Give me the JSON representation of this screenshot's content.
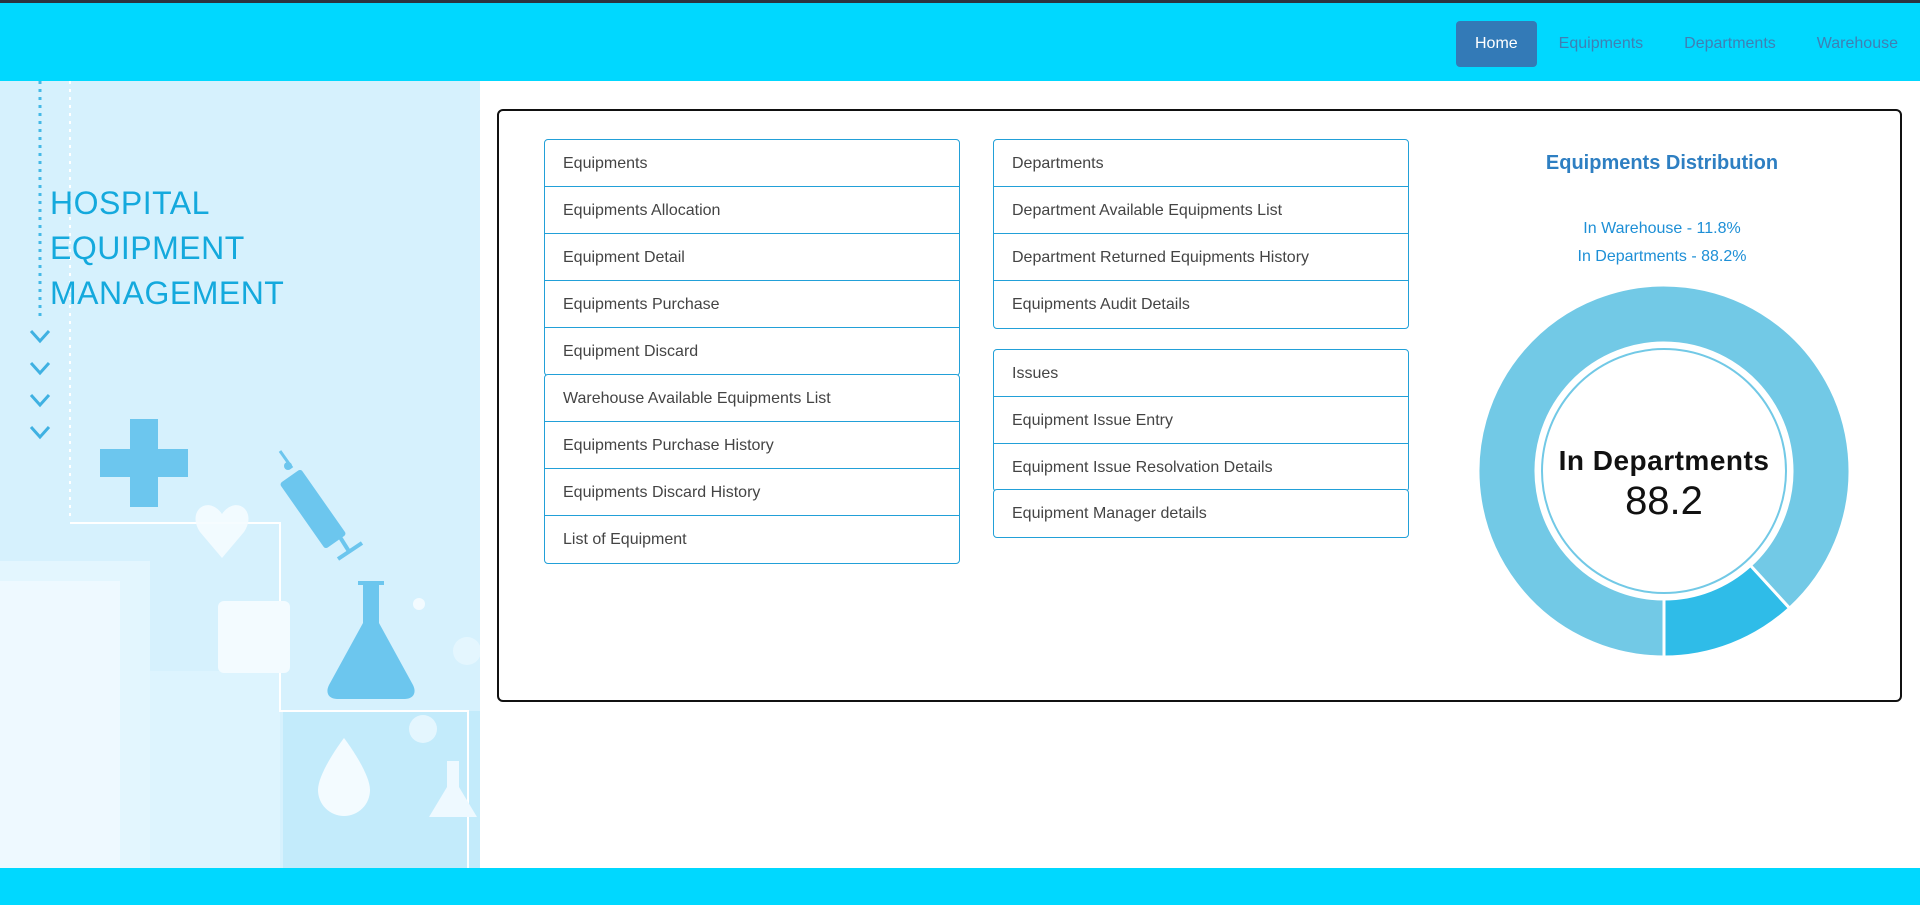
{
  "nav": {
    "items": [
      "Home",
      "Equipments",
      "Departments",
      "Warehouse"
    ]
  },
  "sidebar": {
    "brand_lines": [
      "HOSPITAL",
      "EQUIPMENT",
      "MANAGEMENT"
    ]
  },
  "groups": {
    "g1": [
      "Equipments",
      "Equipments Allocation",
      "Equipment Detail",
      "Equipments Purchase",
      "Equipment Discard"
    ],
    "g2": [
      "Warehouse Available Equipments List",
      "Equipments Purchase History",
      "Equipments Discard History",
      "List of Equipment"
    ],
    "g3": [
      "Departments",
      "Department Available Equipments List",
      "Department Returned Equipments History",
      "Equipments Audit Details"
    ],
    "g4": [
      "Issues",
      "Equipment Issue Entry",
      "Equipment Issue Resolvation Details"
    ],
    "g5": [
      "Equipment Manager details"
    ]
  },
  "chart": {
    "title": "Equipments Distribution",
    "legend": [
      "In Warehouse - 11.8%",
      "In Departments - 88.2%"
    ],
    "center_label": "In Departments",
    "center_value": "88.2"
  },
  "chart_data": {
    "type": "pie",
    "title": "Equipments Distribution",
    "categories": [
      "In Warehouse",
      "In Departments"
    ],
    "values": [
      11.8,
      88.2
    ],
    "colors": [
      "#2fbce8",
      "#72c9e6"
    ]
  },
  "colors": {
    "header": "#00d8ff",
    "active_nav": "#337ab7",
    "border": "#22a0d8"
  }
}
